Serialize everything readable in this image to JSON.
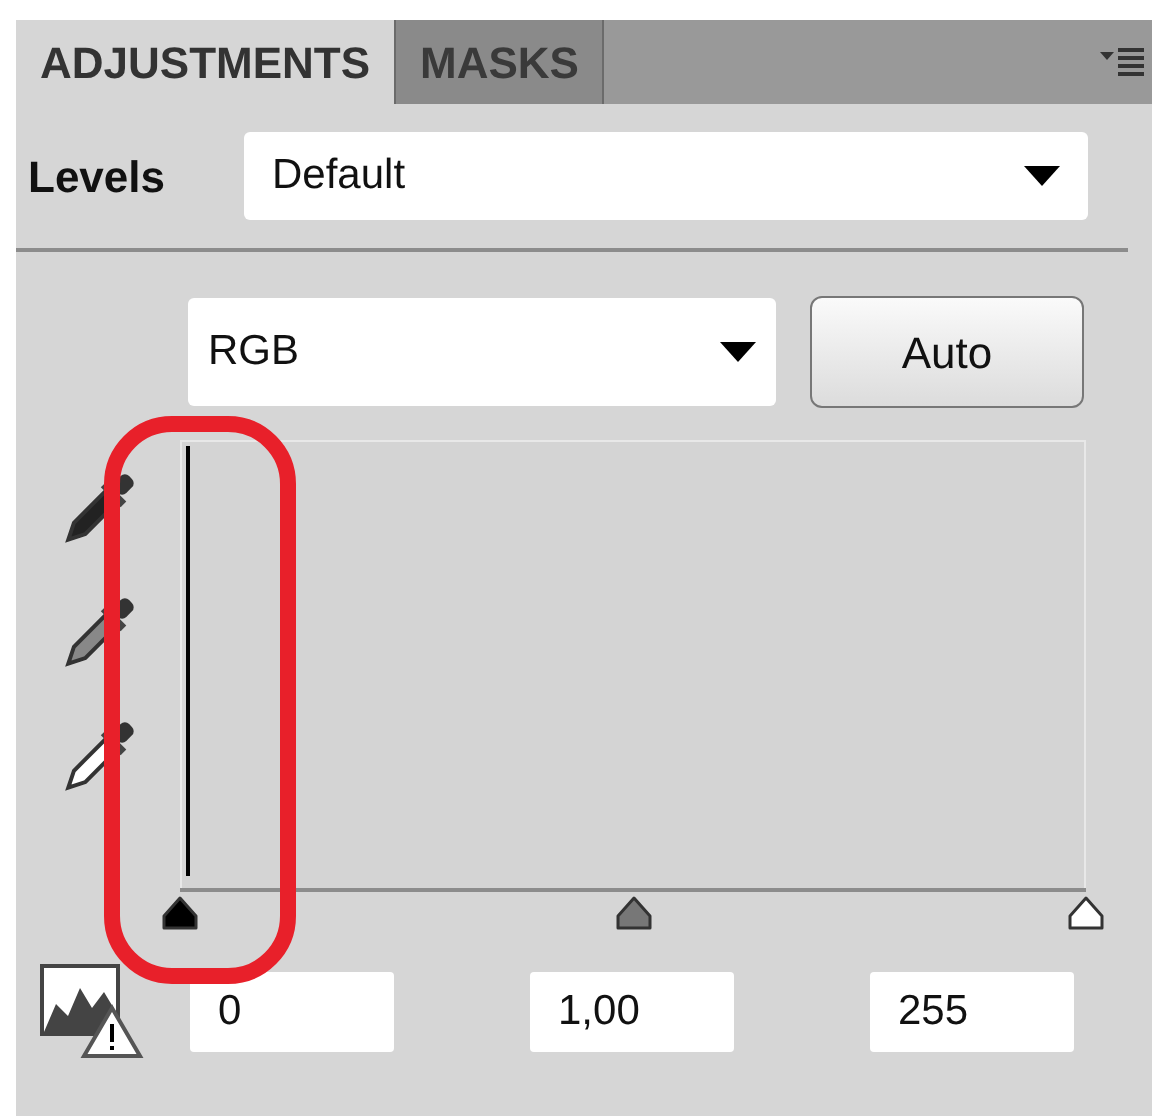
{
  "tabs": [
    {
      "label": "ADJUSTMENTS",
      "selected": true
    },
    {
      "label": "MASKS",
      "selected": false
    }
  ],
  "preset": {
    "label": "Levels",
    "value": "Default"
  },
  "channel": {
    "value": "RGB"
  },
  "auto_button": "Auto",
  "input_sliders": [
    {
      "kind": "black",
      "level": 0
    },
    {
      "kind": "gray",
      "level": 0.5
    },
    {
      "kind": "white",
      "level": 1
    }
  ],
  "input_values": [
    "0",
    "1,00",
    "255"
  ]
}
